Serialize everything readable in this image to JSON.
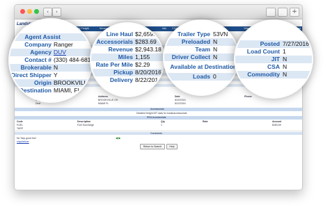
{
  "app": {
    "logo_text": "LandstarOnline",
    "nav_items": [
      "Home",
      "My Freight",
      "Money",
      "Loads",
      "Info",
      "CSAFF",
      "Links"
    ],
    "welcome_text": "Welcome, 2021 09 08/2017 06:00/07 08:02/7 Logout"
  },
  "bubble1": {
    "rows": [
      {
        "label": "Agent Assist",
        "value": ""
      },
      {
        "label": "Company",
        "value": "Ranger"
      },
      {
        "label": "Agency",
        "value": "DUV"
      },
      {
        "label": "Contact #",
        "value": "(330) 484-6813"
      },
      {
        "label": "Brokerable",
        "value": "N"
      },
      {
        "label": "Direct Shipper",
        "value": "Y"
      },
      {
        "label": "Origin",
        "value": "BROOKVILLE"
      },
      {
        "label": "Destination",
        "value": "MIAMI, FL"
      }
    ]
  },
  "bubble2": {
    "rows": [
      {
        "label": "Line Haul",
        "value": "$2,659."
      },
      {
        "label": "Accessorials",
        "value": "$283.69"
      },
      {
        "label": "Revenue",
        "value": "$2,943.18"
      },
      {
        "label": "Miles",
        "value": "1,155"
      },
      {
        "label": "Rate Per Mile",
        "value": "$2.29"
      },
      {
        "label": "Pickup",
        "value": "8/20/2016"
      },
      {
        "label": "Delivery",
        "value": "8/22/201"
      }
    ]
  },
  "bubble3": {
    "rows": [
      {
        "label": "Trailer Type",
        "value": "53VN"
      },
      {
        "label": "Preloaded",
        "value": "N"
      },
      {
        "label": "Team",
        "value": "N"
      },
      {
        "label": "Driver Collect",
        "value": "N"
      },
      {
        "label": "Available at Destination",
        "value": ""
      },
      {
        "label": "Loads",
        "value": "0"
      }
    ]
  },
  "bubble4": {
    "rows": [
      {
        "label": "Posted",
        "value": "7/27/2016"
      },
      {
        "label": "Load Count",
        "value": "1"
      },
      {
        "label": "JIT",
        "value": "N"
      },
      {
        "label": "CSA",
        "value": "N"
      },
      {
        "label": "Commodity",
        "value": "N"
      }
    ]
  },
  "sections": {
    "accessorials_title": "Accessorials",
    "accessorials_note": "Detailed freight INT data for loads/accessorials",
    "rea_title": "REA Accessorials",
    "comments_title": "Comments"
  },
  "stops_table": {
    "headers": [
      "Stop",
      "Address",
      "Date",
      "Phone"
    ],
    "rows": [
      [
        "Origin",
        "BROOKVILLE OH",
        "8/20/2016",
        ""
      ],
      [
        "Dest",
        "MIAMI FL",
        "8/22/2016",
        ""
      ]
    ]
  },
  "rea_table": {
    "headers": [
      "Code",
      "Description",
      "Qty",
      "Rate",
      "Amount"
    ],
    "rows": [
      [
        "FUEL",
        "Fuel Surcharge",
        "1",
        "",
        "$283.69"
      ],
      [
        "TARP",
        "",
        "",
        "",
        ""
      ]
    ]
  },
  "comments": {
    "line1": "No Tarp good fuel",
    "line2": "ship/deliver"
  },
  "buttons": {
    "return_to_search": "Return to Search",
    "help": "Help"
  },
  "pager_arrows": "◀ ▶",
  "colors": {
    "label_blue": "#1f5aa6",
    "nav_blue": "#1f4f8b",
    "row_shade": "#dce7f4"
  }
}
